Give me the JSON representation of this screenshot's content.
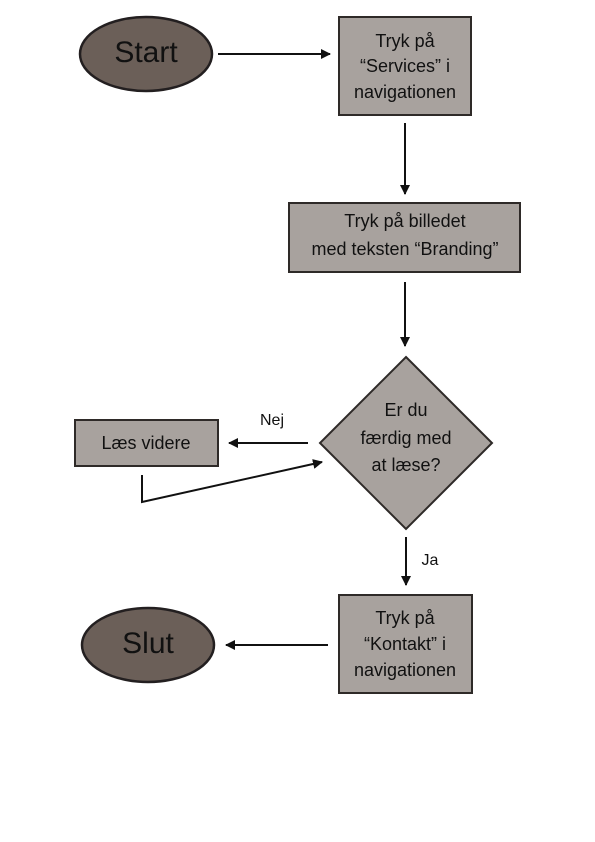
{
  "nodes": {
    "start": "Start",
    "step_services": [
      "Tryk på",
      "“Services” i",
      "navigationen"
    ],
    "step_branding": [
      "Tryk på billedet",
      "med teksten “Branding”"
    ],
    "decision": [
      "Er du",
      "færdig med",
      "at læse?"
    ],
    "read_more": "Læs videre",
    "step_contact": [
      "Tryk på",
      "“Kontakt” i",
      "navigationen"
    ],
    "end": "Slut"
  },
  "edges": {
    "no_label": "Nej",
    "yes_label": "Ja"
  },
  "colors": {
    "box_fill": "#a8a29e",
    "oval_fill": "#6b5f58",
    "stroke": "#2e2a28"
  }
}
